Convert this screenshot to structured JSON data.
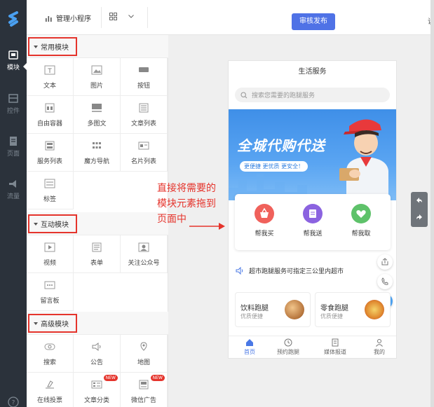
{
  "topbar": {
    "manage_label": "管理小程序",
    "publish_label": "审核发布",
    "cut_text": "说"
  },
  "rail": {
    "items": [
      {
        "label": "模块",
        "icon": "module-icon",
        "active": true
      },
      {
        "label": "控件",
        "icon": "widget-icon",
        "active": false
      },
      {
        "label": "页面",
        "icon": "page-icon",
        "active": false
      },
      {
        "label": "流量",
        "icon": "traffic-icon",
        "active": false
      }
    ]
  },
  "panel": {
    "sections": [
      {
        "title": "常用模块",
        "items": [
          {
            "label": "文本",
            "icon": "text-icon"
          },
          {
            "label": "图片",
            "icon": "image-icon"
          },
          {
            "label": "按钮",
            "icon": "button-icon"
          },
          {
            "label": "自由容器",
            "icon": "container-icon"
          },
          {
            "label": "多图文",
            "icon": "multi-image-text-icon"
          },
          {
            "label": "文章列表",
            "icon": "article-list-icon"
          },
          {
            "label": "服务列表",
            "icon": "service-list-icon"
          },
          {
            "label": "魔方导航",
            "icon": "cube-nav-icon"
          },
          {
            "label": "名片列表",
            "icon": "card-list-icon"
          },
          {
            "label": "标签",
            "icon": "tag-icon"
          }
        ]
      },
      {
        "title": "互动模块",
        "items": [
          {
            "label": "视频",
            "icon": "video-icon"
          },
          {
            "label": "表单",
            "icon": "form-icon"
          },
          {
            "label": "关注公众号",
            "icon": "follow-icon"
          },
          {
            "label": "留言板",
            "icon": "message-board-icon"
          }
        ]
      },
      {
        "title": "高级模块",
        "items": [
          {
            "label": "搜索",
            "icon": "search-icon"
          },
          {
            "label": "公告",
            "icon": "announcement-icon"
          },
          {
            "label": "地图",
            "icon": "map-icon"
          },
          {
            "label": "在线投票",
            "icon": "vote-icon"
          },
          {
            "label": "文章分类",
            "icon": "article-category-icon",
            "badge": "NEW"
          },
          {
            "label": "微信广告",
            "icon": "wechat-ad-icon",
            "badge": "NEW"
          }
        ]
      }
    ]
  },
  "annotation": {
    "line1": "直接将需要的",
    "line2": "模块元素拖到",
    "line3": "页面中"
  },
  "phone": {
    "title": "生活服务",
    "search_placeholder": "搜索您需要的跑腿服务",
    "banner_title": "全城代购代送",
    "banner_slogan": "更便捷 更优质 更安全！",
    "services": [
      {
        "label": "帮我买",
        "color": "#f0615b"
      },
      {
        "label": "帮我送",
        "color": "#8b63e0"
      },
      {
        "label": "帮我取",
        "color": "#5ec26a"
      }
    ],
    "notice": "超市跑腿服务可指定三公里内超市",
    "errands": [
      {
        "title": "饮料跑腿",
        "subtitle": "优质便捷"
      },
      {
        "title": "零食跑腿",
        "subtitle": "优质便捷"
      }
    ],
    "tabs": [
      {
        "label": "首页",
        "active": true
      },
      {
        "label": "预约跑腿",
        "active": false
      },
      {
        "label": "媒体报道",
        "active": false
      },
      {
        "label": "我的",
        "active": false
      }
    ]
  },
  "colors": {
    "accent": "#4f72e6",
    "highlight": "#e5342c",
    "rail": "#2b323b"
  }
}
